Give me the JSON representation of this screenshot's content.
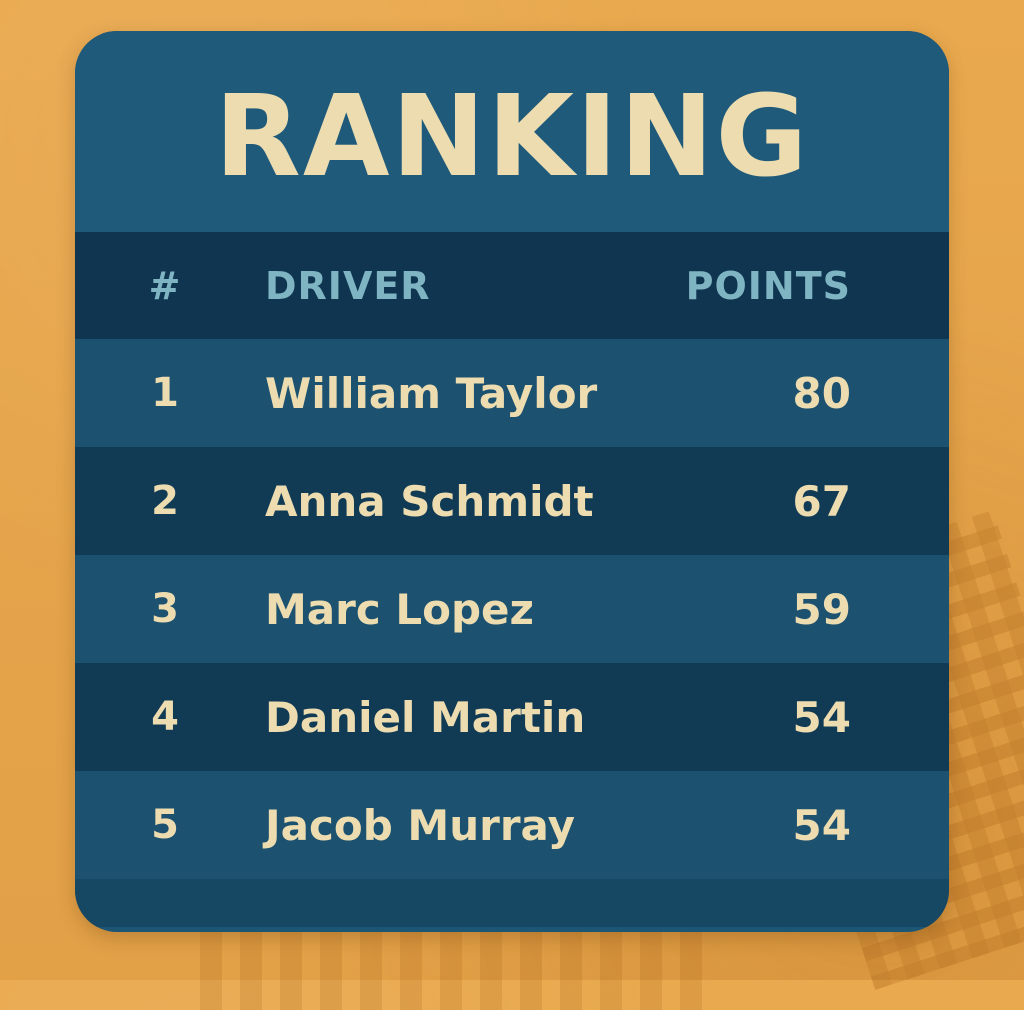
{
  "board": {
    "title": "RANKING",
    "columns": {
      "rank": "#",
      "driver": "DRIVER",
      "points": "POINTS"
    },
    "rows": [
      {
        "rank": "1",
        "driver": "William Taylor",
        "points": "80"
      },
      {
        "rank": "2",
        "driver": "Anna Schmidt",
        "points": "67"
      },
      {
        "rank": "3",
        "driver": "Marc Lopez",
        "points": "59"
      },
      {
        "rank": "4",
        "driver": "Daniel Martin",
        "points": "54"
      },
      {
        "rank": "5",
        "driver": "Jacob Murray",
        "points": "54"
      }
    ]
  },
  "colors": {
    "background": "#e6a54b",
    "card": "#1d5675",
    "header_row": "#0f3550",
    "row_light": "#1c5170",
    "row_dark": "#113a55",
    "title_text": "#ecdcb0",
    "header_text": "#7fb5c3",
    "row_text": "#ecdcb0"
  }
}
